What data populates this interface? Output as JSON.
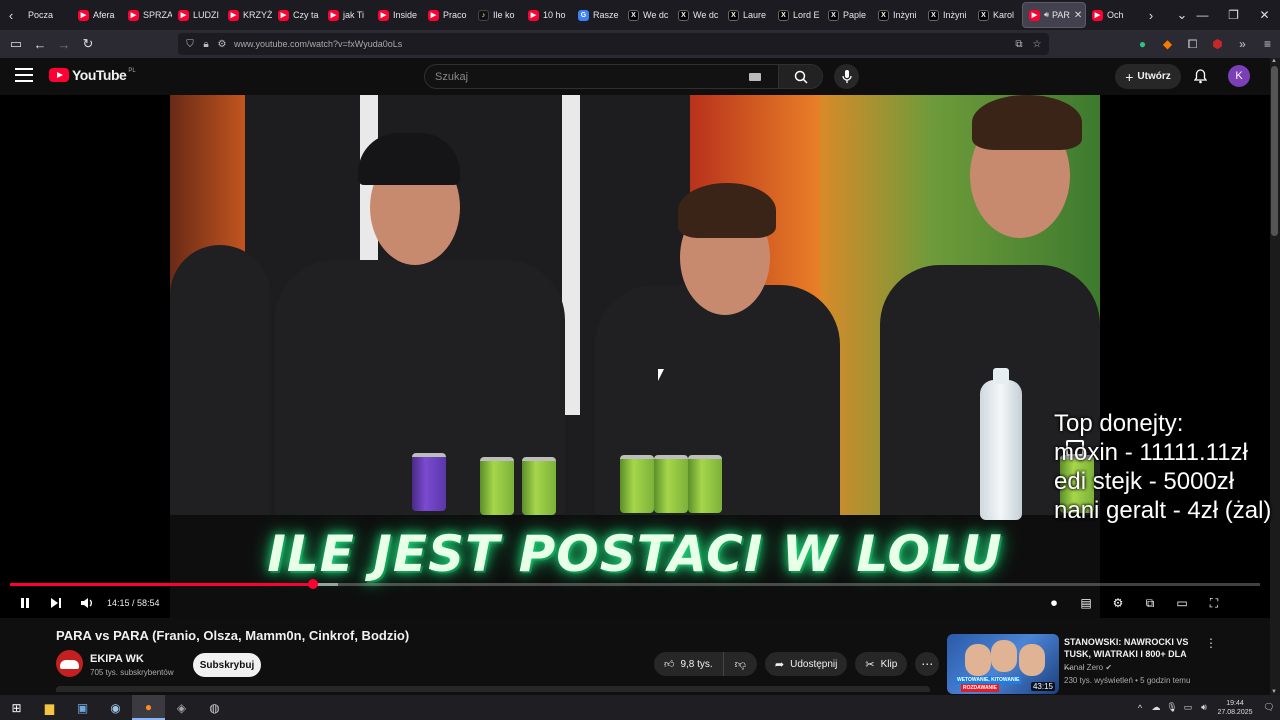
{
  "browser": {
    "tabs": [
      {
        "label": "Pocza",
        "icon": "none"
      },
      {
        "label": "Afera",
        "icon": "youtube"
      },
      {
        "label": "SPRZA",
        "icon": "youtube"
      },
      {
        "label": "LUDZI",
        "icon": "youtube"
      },
      {
        "label": "KRZYŻ",
        "icon": "youtube"
      },
      {
        "label": "Czy ta",
        "icon": "youtube"
      },
      {
        "label": "jak Ti",
        "icon": "youtube"
      },
      {
        "label": "Inside",
        "icon": "youtube"
      },
      {
        "label": "Praco",
        "icon": "youtube"
      },
      {
        "label": "Ile ko",
        "icon": "tiktok"
      },
      {
        "label": "10 ho",
        "icon": "youtube"
      },
      {
        "label": "Rasze",
        "icon": "go"
      },
      {
        "label": "We dc",
        "icon": "x"
      },
      {
        "label": "We dc",
        "icon": "x"
      },
      {
        "label": "Laure",
        "icon": "x"
      },
      {
        "label": "Lord E",
        "icon": "x"
      },
      {
        "label": "Paple",
        "icon": "x"
      },
      {
        "label": "Inżyni",
        "icon": "x"
      },
      {
        "label": "Inżyni",
        "icon": "x"
      },
      {
        "label": "Karol",
        "icon": "x"
      },
      {
        "label": "PAR",
        "icon": "youtube",
        "active": true
      },
      {
        "label": "Och",
        "icon": "youtube"
      }
    ],
    "url": "www.youtube.com/watch?v=fxWyuda0oLs"
  },
  "youtube": {
    "logo_text": "YouTube",
    "country": "PL",
    "search_placeholder": "Szukaj",
    "create_label": "Utwórz",
    "avatar_letter": "K"
  },
  "player": {
    "caption": "ILE JEST POSTACI W LOLU",
    "current_time": "14:15",
    "duration": "58:54",
    "time_display": "14:15 / 58:54",
    "progress_fraction": 0.242,
    "buffered_fraction": 0.262,
    "overlay_lines": [
      "Top donejty:",
      "moxin - 11111.11zł",
      "edi stejk - 5000zł",
      "nani geralt - 4zł (żal)"
    ]
  },
  "video": {
    "title": "PARA vs PARA (Franio, Olsza, Mamm0n, Cinkrof, Bodzio)",
    "channel": "EKIPA WK",
    "subscribers": "705 tys. subskrybentów",
    "subscribe_label": "Subskrybuj",
    "likes": "9,8 tys.",
    "share_label": "Udostępnij",
    "clip_label": "Klip"
  },
  "recommendation": {
    "title": "STANOWSKI: NAWROCKI VS TUSK, WIATRAKI I 800+ DLA ...",
    "channel": "Kanał Zero",
    "meta": "230 tys. wyświetleń • 5 godzin temu",
    "duration": "43:15",
    "thumb_tag1": "WETOWANIE, KITOWANIE",
    "thumb_tag2": "ROZDAWANIE"
  },
  "taskbar": {
    "time": "19:44",
    "date": "27.08.2025"
  }
}
